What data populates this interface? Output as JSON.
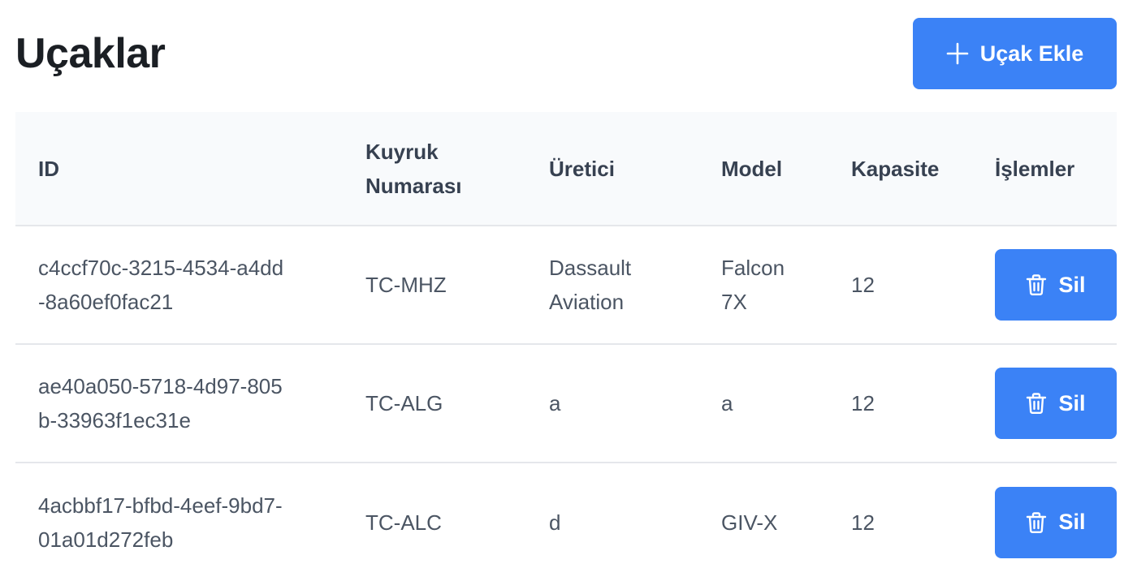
{
  "page": {
    "title": "Uçaklar",
    "add_button_label": "Uçak Ekle",
    "add_icon": "plus-icon",
    "accent_color": "#3b82f6"
  },
  "table": {
    "columns": [
      {
        "label": "ID"
      },
      {
        "label": "Kuyruk Numarası"
      },
      {
        "label": "Üretici"
      },
      {
        "label": "Model"
      },
      {
        "label": "Kapasite"
      },
      {
        "label": "İşlemler"
      }
    ],
    "rows": [
      {
        "id": "c4ccf70c-3215-4534-a4dd-8a60ef0fac21",
        "tail_number": "TC-MHZ",
        "manufacturer": "Dassault Aviation",
        "model": "Falcon 7X",
        "capacity": "12",
        "delete_label": "Sil",
        "delete_icon": "trash-icon"
      },
      {
        "id": "ae40a050-5718-4d97-805b-33963f1ec31e",
        "tail_number": "TC-ALG",
        "manufacturer": "a",
        "model": "a",
        "capacity": "12",
        "delete_label": "Sil",
        "delete_icon": "trash-icon"
      },
      {
        "id": "4acbbf17-bfbd-4eef-9bd7-01a01d272feb",
        "tail_number": "TC-ALC",
        "manufacturer": "d",
        "model": "GIV-X",
        "capacity": "12",
        "delete_label": "Sil",
        "delete_icon": "trash-icon"
      }
    ]
  }
}
